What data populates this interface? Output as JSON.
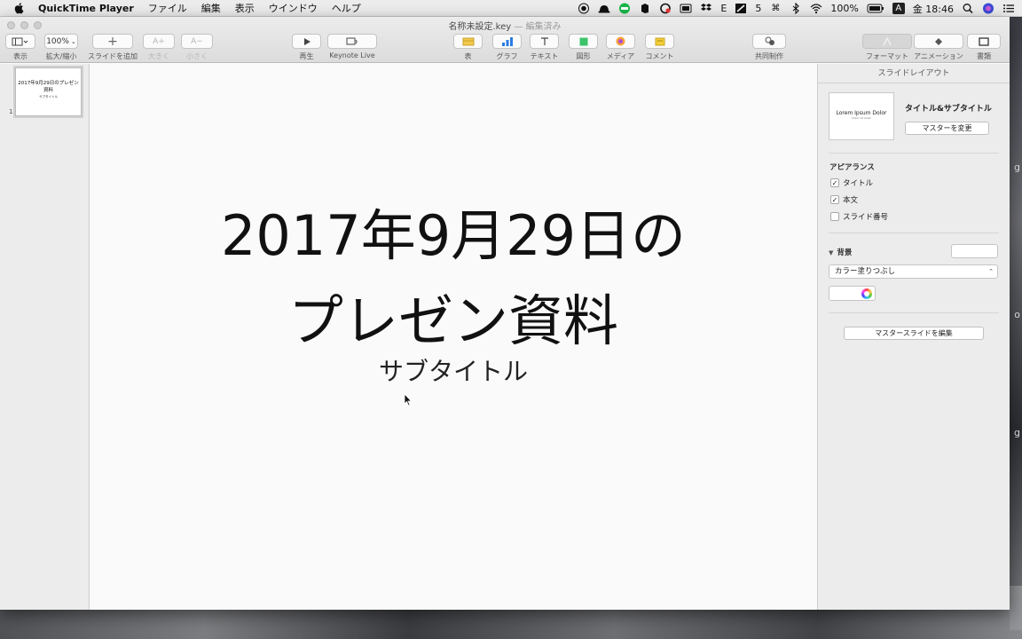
{
  "menubar": {
    "app_name": "QuickTime Player",
    "items": [
      "ファイル",
      "編集",
      "表示",
      "ウインドウ",
      "ヘルプ"
    ],
    "status": {
      "battery": "100%",
      "clock": "金 18:46",
      "input_mode": "A",
      "e_label": "E",
      "five_label": "5"
    }
  },
  "window": {
    "doc_title": "名称未設定.key",
    "doc_subtitle": "— 編集済み"
  },
  "toolbar": {
    "view": "表示",
    "zoom_value": "100%",
    "zoom": "拡大/縮小",
    "add_slide": "スライドを追加",
    "bigger": "大きく",
    "smaller": "小さく",
    "play": "再生",
    "keynote_live": "Keynote Live",
    "table": "表",
    "chart": "グラフ",
    "text": "テキスト",
    "shape": "図形",
    "media": "メディア",
    "comment": "コメント",
    "collaborate": "共同制作",
    "format": "フォーマット",
    "animation": "アニメーション",
    "document": "書類"
  },
  "navigator": {
    "thumb_title": "2017年9月29日のプレゼン資料",
    "thumb_subtitle": "サブタイトル",
    "slide_number": "1"
  },
  "slide": {
    "title_line1": "2017年9月29日の",
    "title_line2": "プレゼン資料",
    "subtitle": "サブタイトル"
  },
  "inspector": {
    "header": "スライドレイアウト",
    "layout_preview": "Lorem Ipsum Dolor",
    "layout_preview_sub": "Dolor sit amet",
    "layout_name": "タイトル&サブタイトル",
    "change_master": "マスターを変更",
    "appearance_label": "アピアランス",
    "checkboxes": [
      {
        "label": "タイトル",
        "checked": true
      },
      {
        "label": "本文",
        "checked": true
      },
      {
        "label": "スライド番号",
        "checked": false
      }
    ],
    "background_label": "背景",
    "fill_option": "カラー塗りつぶし",
    "edit_master": "マスタースライドを編集"
  },
  "desktop": {
    "edge_chars": [
      "g",
      "o",
      "g"
    ]
  },
  "colors": {
    "window_bg": "#fafafa",
    "toolbar_bg": "#e3e3e3",
    "text": "#111111"
  }
}
